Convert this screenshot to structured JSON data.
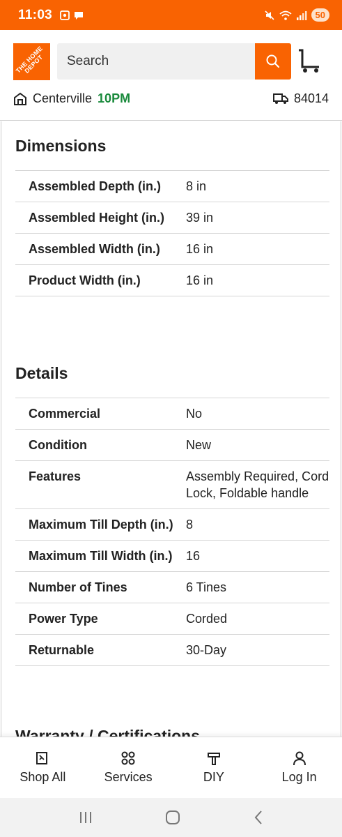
{
  "status_bar": {
    "time": "11:03",
    "battery": "50"
  },
  "header": {
    "logo_text": "THE HOME DEPOT",
    "search": {
      "placeholder": "Search"
    },
    "store": {
      "name": "Centerville",
      "hours": "10PM"
    },
    "delivery_zip": "84014"
  },
  "sections": {
    "dimensions": {
      "title": "Dimensions",
      "rows": [
        {
          "name": "Assembled Depth (in.)",
          "value": "8 in"
        },
        {
          "name": "Assembled Height (in.)",
          "value": "39 in"
        },
        {
          "name": "Assembled Width (in.)",
          "value": "16 in"
        },
        {
          "name": "Product Width (in.)",
          "value": "16 in"
        }
      ]
    },
    "details": {
      "title": "Details",
      "rows": [
        {
          "name": "Commercial",
          "value": "No"
        },
        {
          "name": "Condition",
          "value": "New"
        },
        {
          "name": "Features",
          "value": "Assembly Required, Cord Lock, Foldable handle"
        },
        {
          "name": "Maximum Till Depth (in.)",
          "value": "8"
        },
        {
          "name": "Maximum Till Width (in.)",
          "value": "16"
        },
        {
          "name": "Number of Tines",
          "value": "6 Tines"
        },
        {
          "name": "Power Type",
          "value": "Corded"
        },
        {
          "name": "Returnable",
          "value": "30-Day"
        }
      ]
    },
    "next_section_peek": "Warranty / Certifications"
  },
  "bottom_nav": [
    {
      "label": "Shop All",
      "icon": "shop-all-icon"
    },
    {
      "label": "Services",
      "icon": "services-icon"
    },
    {
      "label": "DIY",
      "icon": "diy-icon"
    },
    {
      "label": "Log In",
      "icon": "user-icon"
    }
  ],
  "colors": {
    "brand": "#f96302",
    "store_hours": "#1a8a3c"
  }
}
